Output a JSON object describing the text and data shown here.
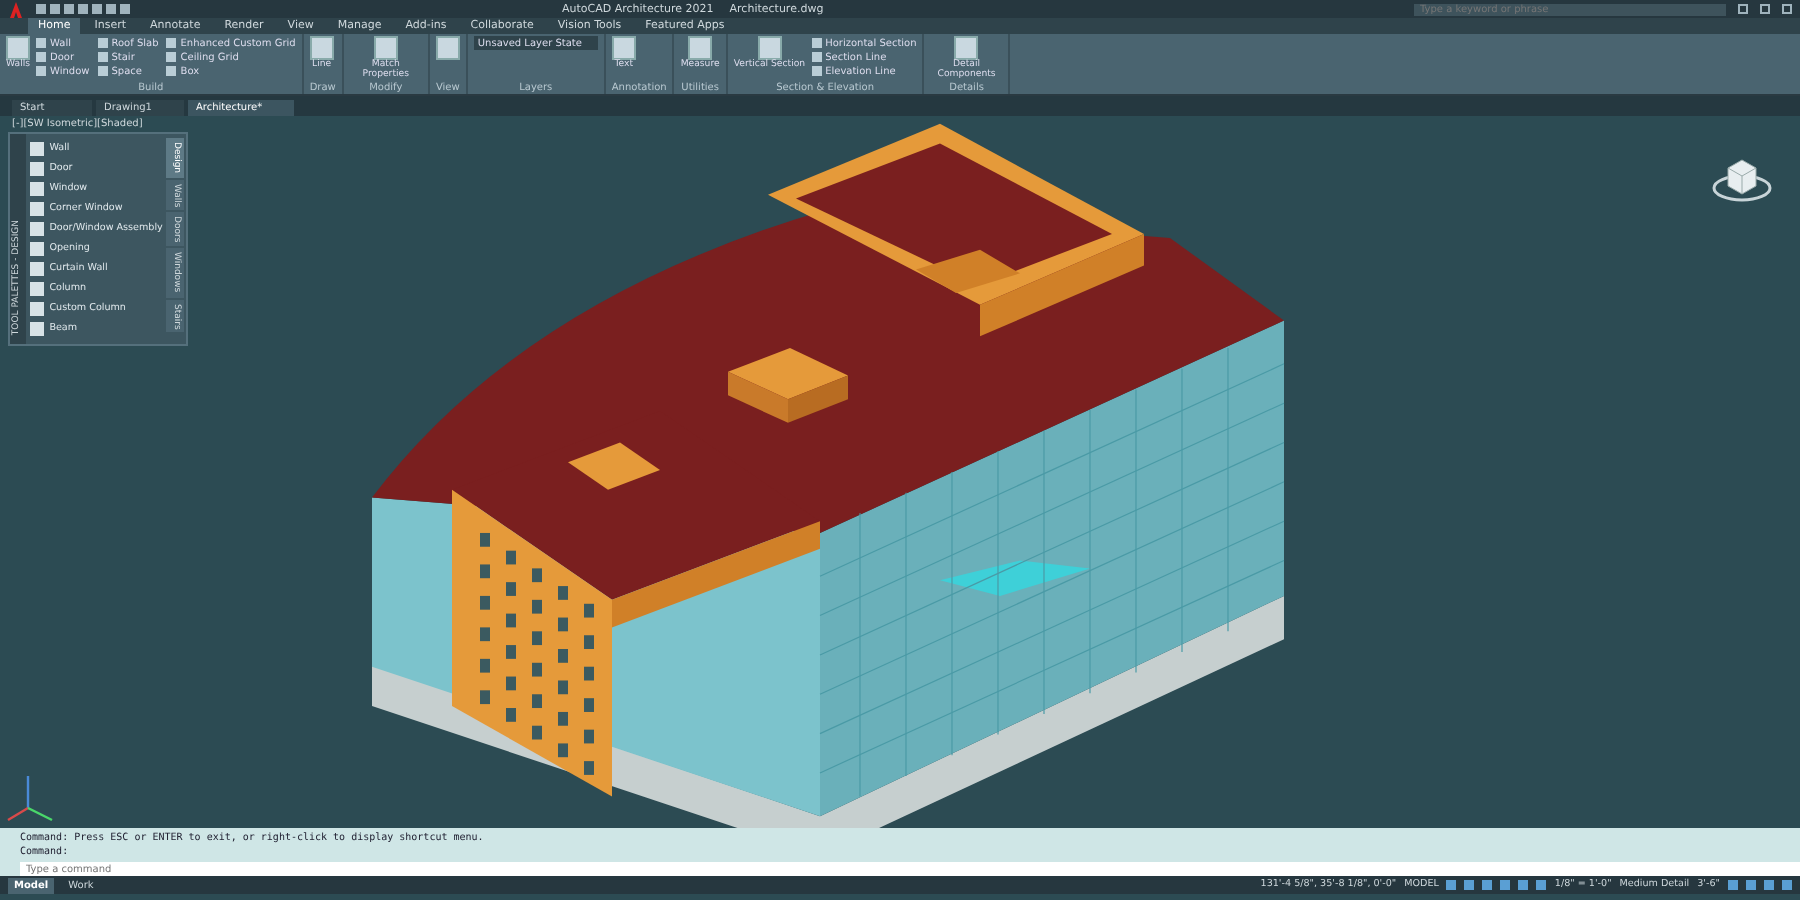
{
  "title_bar": {
    "app_title": "AutoCAD Architecture 2021",
    "file_name": "Architecture.dwg",
    "search_placeholder": "Type a keyword or phrase"
  },
  "ribbon_tabs": [
    {
      "label": "Home",
      "selected": true
    },
    {
      "label": "Insert",
      "selected": false
    },
    {
      "label": "Annotate",
      "selected": false
    },
    {
      "label": "Render",
      "selected": false
    },
    {
      "label": "View",
      "selected": false
    },
    {
      "label": "Manage",
      "selected": false
    },
    {
      "label": "Add-ins",
      "selected": false
    },
    {
      "label": "Collaborate",
      "selected": false
    },
    {
      "label": "Vision Tools",
      "selected": false
    },
    {
      "label": "Featured Apps",
      "selected": false
    }
  ],
  "ribbon_panels": [
    {
      "title": "Build",
      "big_tool": "Walls",
      "tools": [
        "Wall",
        "Door",
        "Window",
        "Roof Slab",
        "Stair",
        "Space",
        "Enhanced Custom Grid",
        "Ceiling Grid",
        "Box"
      ]
    },
    {
      "title": "Draw",
      "big_tool": "Line"
    },
    {
      "title": "Modify",
      "big_tool": "Match Properties"
    },
    {
      "title": "View"
    },
    {
      "title": "Layers",
      "tools": [
        "Unsaved Layer State"
      ]
    },
    {
      "title": "Annotation",
      "big_tool": "Text"
    },
    {
      "title": "Utilities",
      "big_tool": "Measure"
    },
    {
      "title": "Section & Elevation",
      "big_tool": "Vertical Section",
      "tools": [
        "Horizontal Section",
        "Section Line",
        "Elevation Line"
      ]
    },
    {
      "title": "Details",
      "big_tool": "Detail Components"
    }
  ],
  "file_tabs": [
    {
      "label": "Start",
      "selected": false
    },
    {
      "label": "Drawing1",
      "selected": false
    },
    {
      "label": "Architecture*",
      "selected": true
    }
  ],
  "viewport": {
    "view_label": "[-][SW Isometric][Shaded]"
  },
  "tool_palette": {
    "title": "TOOL PALETTES - DESIGN",
    "tabs": [
      {
        "label": "Design",
        "selected": true
      },
      {
        "label": "Walls",
        "selected": false
      },
      {
        "label": "Doors",
        "selected": false
      },
      {
        "label": "Windows",
        "selected": false
      },
      {
        "label": "Stairs",
        "selected": false
      }
    ],
    "tools": [
      "Wall",
      "Door",
      "Window",
      "Corner Window",
      "Door/Window Assembly",
      "Opening",
      "Curtain Wall",
      "Column",
      "Custom Column",
      "Beam"
    ]
  },
  "command_line": {
    "history": [
      "Command:  Press ESC or ENTER to exit, or right-click to display shortcut menu.",
      "Command:"
    ],
    "placeholder": "Type a command"
  },
  "status_bar": {
    "layout_tabs": [
      {
        "label": "Model",
        "selected": true
      },
      {
        "label": "Work",
        "selected": false
      }
    ],
    "coordinates": "131'-4 5/8\", 35'-8 1/8\", 0'-0\"",
    "mode": "MODEL",
    "scale": "1/8\" = 1'-0\"",
    "detail_level": "Medium Detail",
    "elevation": "3'-6\""
  }
}
